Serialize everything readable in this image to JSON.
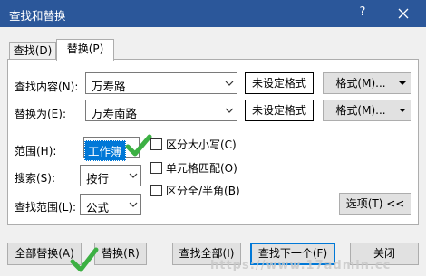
{
  "window": {
    "title": "查找和替换",
    "help_glyph": "?",
    "accent": "#2b579a"
  },
  "tabs": [
    {
      "label": "查找(D)",
      "active": false
    },
    {
      "label": "替换(P)",
      "active": true
    }
  ],
  "find": {
    "label": "查找内容(N):",
    "value": "万寿路",
    "format_status": "未设定格式",
    "format_button": "格式(M)..."
  },
  "replace": {
    "label": "替换为(E):",
    "value": "万寿南路",
    "format_status": "未设定格式",
    "format_button": "格式(M)..."
  },
  "options": {
    "scope_label": "范围(H):",
    "scope_value": "工作簿",
    "search_label": "搜索(S):",
    "search_value": "按行",
    "lookin_label": "查找范围(L):",
    "lookin_value": "公式",
    "match_case": {
      "label": "区分大小写(C)",
      "checked": false
    },
    "match_cell": {
      "label": "单元格匹配(O)",
      "checked": false
    },
    "match_width": {
      "label": "区分全/半角(B)",
      "checked": false
    },
    "options_button": "选项(T) <<"
  },
  "buttons": {
    "replace_all": "全部替换(A)",
    "replace": "替换(R)",
    "find_all": "查找全部(I)",
    "find_next": "查找下一个(F)",
    "close": "关闭"
  },
  "annotations": {
    "check_color": "#3cb043"
  },
  "watermark": "https://www.17admin.cc"
}
